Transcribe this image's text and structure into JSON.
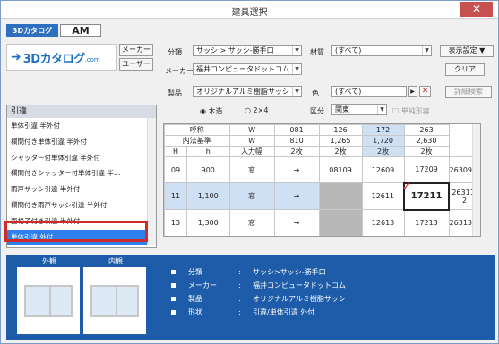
{
  "window": {
    "title": "建具選択",
    "close": "✕"
  },
  "tabs": [
    {
      "label": "3Dカタログ"
    },
    {
      "label": "AM"
    }
  ],
  "logo": {
    "arrow": "➜",
    "text": "3Dカタログ",
    "com": ".com"
  },
  "maker_btn": "メーカー",
  "user_btn": "ユーザー",
  "filters": {
    "category_label": "分類",
    "category_value": "サッシ > サッシ-勝手口",
    "material_label": "材質",
    "material_value": "(すべて)",
    "maker_label": "メーカー",
    "maker_value": "福井コンピュータドットコム",
    "product_label": "製品",
    "product_value": "オリジナルアルミ樹脂サッシ",
    "color_label": "色",
    "color_value": "(すべて)",
    "radio1": "木造",
    "radio2": "2×4",
    "region_label": "区分",
    "region_value": "関東",
    "single_slide": "単純形容"
  },
  "buttons": {
    "display_settings": "表示設定",
    "clear": "クリア",
    "detail_search": "詳細検索"
  },
  "list": {
    "header": "引違",
    "items": [
      "単体引違 半外付",
      "欄間付き単体引違 半外付",
      "シャッター付単体引違 半外付",
      "欄間付きシャッター付単体引違 半…",
      "雨戸サッシ引違 半外付",
      "欄間付き雨戸サッシ引違 半外付",
      "面格子付き引違 半外付",
      "単体引違 外付"
    ],
    "selected": "単体引違 外付"
  },
  "grid": {
    "h0": [
      "呼称",
      "W"
    ],
    "h1": [
      "内法基準",
      "W"
    ],
    "h2": [
      "H",
      "h",
      "入力幅"
    ],
    "cols": [
      "081",
      "126",
      "172",
      "263"
    ],
    "widths": [
      "810",
      "1,265",
      "1,720",
      "2,630"
    ],
    "sheets": [
      "2枚",
      "2枚",
      "2枚",
      "2枚"
    ],
    "rows": [
      {
        "code": "09",
        "h": "900",
        "type": "窓",
        "arrow": "→",
        "cells": [
          "08109",
          "12609",
          "17209",
          "26309-2"
        ]
      },
      {
        "code": "11",
        "h": "1,100",
        "type": "窓",
        "arrow": "→",
        "cells": [
          "",
          "12611",
          "17211",
          "26311-2"
        ]
      },
      {
        "code": "13",
        "h": "1,300",
        "type": "窓",
        "arrow": "→",
        "cells": [
          "",
          "12613",
          "17213",
          "26313-2"
        ]
      }
    ]
  },
  "preview": {
    "exterior": "外観",
    "interior": "内観"
  },
  "info": [
    {
      "k": "分類",
      "v": "サッシ>サッシ-勝手口"
    },
    {
      "k": "メーカー",
      "v": "福井コンピュータドットコム"
    },
    {
      "k": "製品",
      "v": "オリジナルアルミ樹脂サッシ"
    },
    {
      "k": "形状",
      "v": "引違/単体引違 外付"
    }
  ],
  "colon": ":"
}
